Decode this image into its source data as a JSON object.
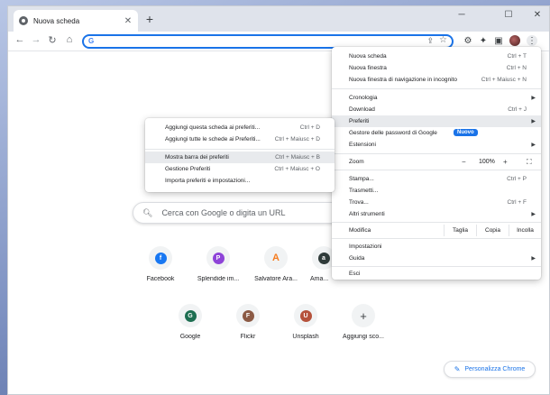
{
  "tab": {
    "title": "Nuova scheda",
    "close": "✕",
    "new_tab": "+"
  },
  "window_controls": {
    "minimize": "─",
    "maximize": "☐",
    "close": "✕"
  },
  "search": {
    "placeholder": "Cerca con Google o digita un URL"
  },
  "shortcuts": [
    {
      "label": "Facebook",
      "letter": "f",
      "color": "#1877f2"
    },
    {
      "label": "Splendide im...",
      "letter": "P",
      "color": "#8e44d8"
    },
    {
      "label": "Salvatore Ara...",
      "letter": "A",
      "color": "#f57c1f"
    },
    {
      "label": "Ama...",
      "letter": "a",
      "color": "#2f3b3a"
    },
    {
      "label": "Google",
      "letter": "G",
      "color": "#1e6f52"
    },
    {
      "label": "Flickr",
      "letter": "F",
      "color": "#8b5a45"
    },
    {
      "label": "Unsplash",
      "letter": "U",
      "color": "#b5523b"
    },
    {
      "label": "Aggiungi sco...",
      "letter": "+",
      "color": "#3c4043"
    }
  ],
  "customize": {
    "label": "Personalizza Chrome"
  },
  "main_menu": {
    "items": [
      {
        "label": "Nuova scheda",
        "shortcut": "Ctrl + T"
      },
      {
        "label": "Nuova finestra",
        "shortcut": "Ctrl + N"
      },
      {
        "label": "Nuova finestra di navigazione in incognito",
        "shortcut": "Ctrl + Maiusc + N"
      },
      {
        "label": "Cronologia",
        "shortcut": ""
      },
      {
        "label": "Download",
        "shortcut": "Ctrl + J"
      },
      {
        "label": "Preferiti",
        "shortcut": ""
      },
      {
        "label": "Gestore delle password di Google",
        "shortcut": ""
      },
      {
        "label": "Estensioni",
        "shortcut": ""
      },
      {
        "label": "Zoom",
        "shortcut": ""
      },
      {
        "label": "Stampa...",
        "shortcut": "Ctrl + P"
      },
      {
        "label": "Trasmetti...",
        "shortcut": ""
      },
      {
        "label": "Trova...",
        "shortcut": "Ctrl + F"
      },
      {
        "label": "Altri strumenti",
        "shortcut": ""
      },
      {
        "label": "Modifica",
        "shortcut": ""
      },
      {
        "label": "Impostazioni",
        "shortcut": ""
      },
      {
        "label": "Guida",
        "shortcut": ""
      },
      {
        "label": "Esci",
        "shortcut": ""
      }
    ],
    "badge": "Nuovo",
    "zoom": {
      "minus": "−",
      "value": "100%",
      "plus": "+",
      "fullscreen": "⛶"
    },
    "edit": {
      "cut": "Taglia",
      "copy": "Copia",
      "paste": "Incolla"
    }
  },
  "bookmarks_submenu": {
    "items": [
      {
        "label": "Aggiungi questa scheda ai preferiti...",
        "shortcut": "Ctrl + D"
      },
      {
        "label": "Aggiungi tutte le schede ai Preferiti...",
        "shortcut": "Ctrl + Maiusc + D"
      },
      {
        "label": "Mostra barra dei preferiti",
        "shortcut": "Ctrl + Maiusc + B"
      },
      {
        "label": "Gestione Preferiti",
        "shortcut": "Ctrl + Maiusc + O"
      },
      {
        "label": "Importa preferiti e impostazioni...",
        "shortcut": ""
      }
    ]
  }
}
